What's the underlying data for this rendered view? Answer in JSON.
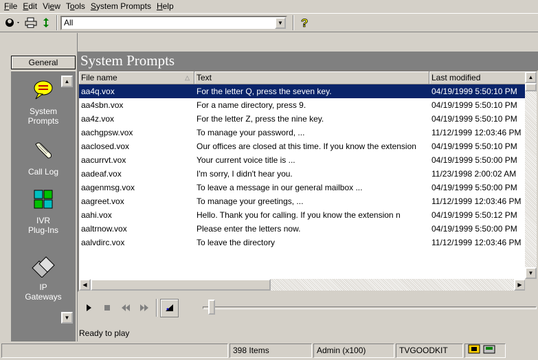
{
  "menu": [
    {
      "mnemonic": "F",
      "rest": "ile"
    },
    {
      "mnemonic": "E",
      "rest": "dit"
    },
    {
      "pre": "Vi",
      "mnemonic": "e",
      "rest": "w"
    },
    {
      "pre": "T",
      "mnemonic": "o",
      "rest": "ols"
    },
    {
      "mnemonic": "S",
      "rest": "ystem Prompts"
    },
    {
      "mnemonic": "H",
      "rest": "elp"
    }
  ],
  "toolbar": {
    "filter_value": "All",
    "icons": [
      "user-select-icon",
      "print-icon",
      "refresh-icon",
      "help-icon"
    ]
  },
  "sidebar": {
    "group_label": "General",
    "items": [
      {
        "label_line1": "System",
        "label_line2": "Prompts",
        "icon": "speech-bubble-icon"
      },
      {
        "label_line1": "Call Log",
        "label_line2": "",
        "icon": "scroll-icon"
      },
      {
        "label_line1": "IVR",
        "label_line2": "Plug-Ins",
        "icon": "puzzle-icon"
      },
      {
        "label_line1": "IP",
        "label_line2": "Gateways",
        "icon": "phones-icon"
      }
    ]
  },
  "main": {
    "title": "System Prompts",
    "columns": [
      "File name",
      "Text",
      "Last modified"
    ],
    "rows": [
      {
        "file": "aa4q.vox",
        "text": "For the letter Q, press the seven key.",
        "modified": "04/19/1999 5:50:10 PM",
        "selected": true
      },
      {
        "file": "aa4sbn.vox",
        "text": "For a name directory, press 9.",
        "modified": "04/19/1999 5:50:10 PM"
      },
      {
        "file": "aa4z.vox",
        "text": "For the letter Z, press the nine key.",
        "modified": "04/19/1999 5:50:10 PM"
      },
      {
        "file": "aachgpsw.vox",
        "text": "To manage your password, ...",
        "modified": "11/12/1999 12:03:46 PM"
      },
      {
        "file": "aaclosed.vox",
        "text": "Our offices are closed at this time. If you know the extension",
        "modified": "04/19/1999 5:50:10 PM"
      },
      {
        "file": "aacurrvt.vox",
        "text": "Your current voice title is ...",
        "modified": "04/19/1999 5:50:00 PM"
      },
      {
        "file": "aadeaf.vox",
        "text": "I'm sorry, I didn't hear you.",
        "modified": "11/23/1998 2:00:02 AM"
      },
      {
        "file": "aagenmsg.vox",
        "text": "To leave a message in our general mailbox ...",
        "modified": "04/19/1999 5:50:00 PM"
      },
      {
        "file": "aagreet.vox",
        "text": "To manage your greetings, ...",
        "modified": "11/12/1999 12:03:46 PM"
      },
      {
        "file": "aahi.vox",
        "text": "Hello. Thank you for calling. If you know the extension n",
        "modified": "04/19/1999 5:50:12 PM"
      },
      {
        "file": "aaltrnow.vox",
        "text": "Please enter the letters now.",
        "modified": "04/19/1999 5:50:00 PM"
      },
      {
        "file": "aalvdirc.vox",
        "text": "To leave the directory",
        "modified": "11/12/1999 12:03:46 PM"
      }
    ],
    "player_status": "Ready to play"
  },
  "statusbar": {
    "items_count": "398 Items",
    "user": "Admin (x100)",
    "server": "TVGOODKIT"
  },
  "colors": {
    "selection": "#0a246a",
    "panel": "#808080",
    "face": "#d4d0c8"
  }
}
